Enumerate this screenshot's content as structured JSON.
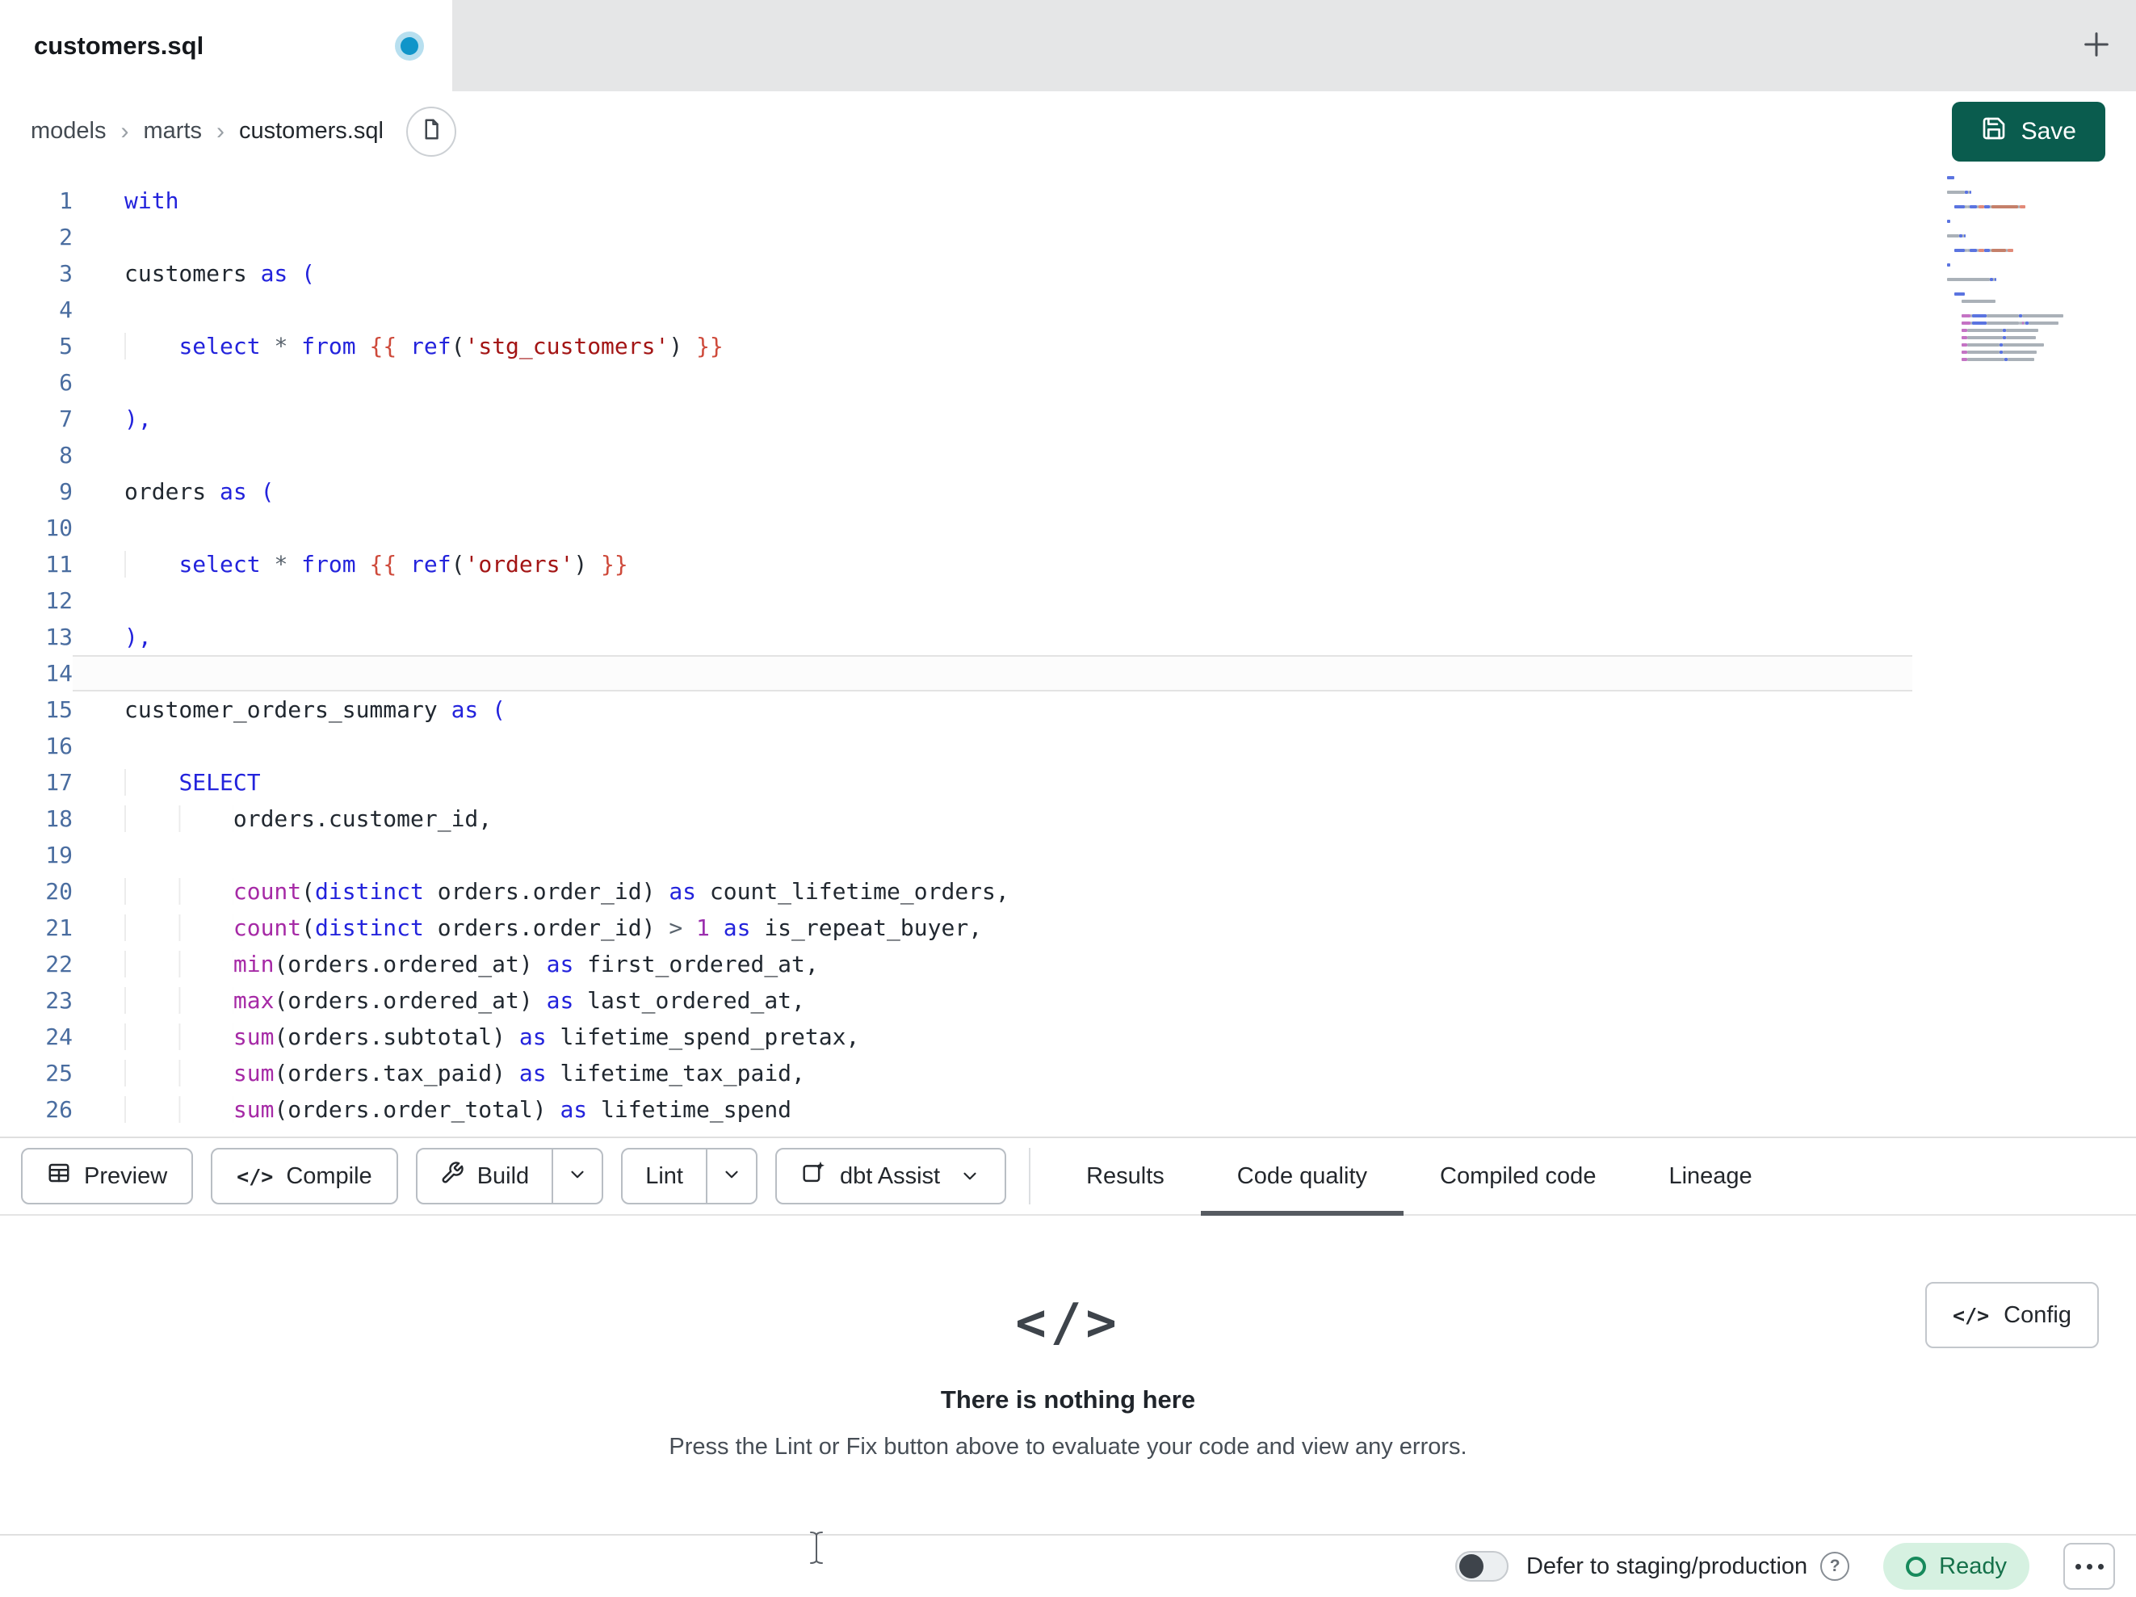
{
  "window": {
    "tab_title": "customers.sql",
    "new_tab": "+"
  },
  "breadcrumb": {
    "items": [
      "models",
      "marts",
      "customers.sql"
    ],
    "separator": "›"
  },
  "header": {
    "save_label": "Save"
  },
  "editor": {
    "active_line": 14,
    "lines": [
      [
        [
          "kw",
          "with"
        ]
      ],
      [],
      [
        [
          "pl",
          "customers "
        ],
        [
          "kw",
          "as"
        ],
        [
          "pl",
          " "
        ],
        [
          "kw",
          "("
        ]
      ],
      [],
      [
        [
          "ind",
          "    "
        ],
        [
          "kw",
          "select"
        ],
        [
          "pl",
          " "
        ],
        [
          "op",
          "*"
        ],
        [
          "pl",
          " "
        ],
        [
          "kw",
          "from"
        ],
        [
          "pl",
          " "
        ],
        [
          "jj",
          "{{ "
        ],
        [
          "kw",
          "ref"
        ],
        [
          "pl",
          "("
        ],
        [
          "st",
          "'stg_customers'"
        ],
        [
          "pl",
          ")"
        ],
        [
          "jj",
          " }}"
        ]
      ],
      [],
      [
        [
          "kw",
          "),"
        ]
      ],
      [],
      [
        [
          "pl",
          "orders "
        ],
        [
          "kw",
          "as"
        ],
        [
          "pl",
          " "
        ],
        [
          "kw",
          "("
        ]
      ],
      [],
      [
        [
          "ind",
          "    "
        ],
        [
          "kw",
          "select"
        ],
        [
          "pl",
          " "
        ],
        [
          "op",
          "*"
        ],
        [
          "pl",
          " "
        ],
        [
          "kw",
          "from"
        ],
        [
          "pl",
          " "
        ],
        [
          "jj",
          "{{ "
        ],
        [
          "kw",
          "ref"
        ],
        [
          "pl",
          "("
        ],
        [
          "st",
          "'orders'"
        ],
        [
          "pl",
          ")"
        ],
        [
          "jj",
          " }}"
        ]
      ],
      [],
      [
        [
          "kw",
          "),"
        ]
      ],
      [],
      [
        [
          "pl",
          "customer_orders_summary "
        ],
        [
          "kw",
          "as"
        ],
        [
          "pl",
          " "
        ],
        [
          "kw",
          "("
        ]
      ],
      [],
      [
        [
          "ind",
          "    "
        ],
        [
          "kw",
          "SELECT"
        ]
      ],
      [
        [
          "ind",
          "        "
        ],
        [
          "pl",
          "orders.customer_id,"
        ]
      ],
      [],
      [
        [
          "ind",
          "        "
        ],
        [
          "fn",
          "count"
        ],
        [
          "pl",
          "("
        ],
        [
          "kw",
          "distinct"
        ],
        [
          "pl",
          " orders.order_id) "
        ],
        [
          "kw",
          "as"
        ],
        [
          "pl",
          " count_lifetime_orders,"
        ]
      ],
      [
        [
          "ind",
          "        "
        ],
        [
          "fn",
          "count"
        ],
        [
          "pl",
          "("
        ],
        [
          "kw",
          "distinct"
        ],
        [
          "pl",
          " orders.order_id) "
        ],
        [
          "op",
          ">"
        ],
        [
          "pl",
          " "
        ],
        [
          "nm",
          "1"
        ],
        [
          "pl",
          " "
        ],
        [
          "kw",
          "as"
        ],
        [
          "pl",
          " is_repeat_buyer,"
        ]
      ],
      [
        [
          "ind",
          "        "
        ],
        [
          "fn",
          "min"
        ],
        [
          "pl",
          "(orders.ordered_at) "
        ],
        [
          "kw",
          "as"
        ],
        [
          "pl",
          " first_ordered_at,"
        ]
      ],
      [
        [
          "ind",
          "        "
        ],
        [
          "fn",
          "max"
        ],
        [
          "pl",
          "(orders.ordered_at) "
        ],
        [
          "kw",
          "as"
        ],
        [
          "pl",
          " last_ordered_at,"
        ]
      ],
      [
        [
          "ind",
          "        "
        ],
        [
          "fn",
          "sum"
        ],
        [
          "pl",
          "(orders.subtotal) "
        ],
        [
          "kw",
          "as"
        ],
        [
          "pl",
          " lifetime_spend_pretax,"
        ]
      ],
      [
        [
          "ind",
          "        "
        ],
        [
          "fn",
          "sum"
        ],
        [
          "pl",
          "(orders.tax_paid) "
        ],
        [
          "kw",
          "as"
        ],
        [
          "pl",
          " lifetime_tax_paid,"
        ]
      ],
      [
        [
          "ind",
          "        "
        ],
        [
          "fn",
          "sum"
        ],
        [
          "pl",
          "(orders.order_total) "
        ],
        [
          "kw",
          "as"
        ],
        [
          "pl",
          " lifetime_spend"
        ]
      ]
    ]
  },
  "toolbar": {
    "preview": "Preview",
    "compile": "Compile",
    "build": "Build",
    "lint": "Lint",
    "assist": "dbt Assist",
    "compile_glyph": "</>",
    "tabs": [
      {
        "label": "Results",
        "active": false
      },
      {
        "label": "Code quality",
        "active": true
      },
      {
        "label": "Compiled code",
        "active": false
      },
      {
        "label": "Lineage",
        "active": false
      }
    ]
  },
  "results_panel": {
    "config_label": "Config",
    "config_glyph": "</>",
    "empty_icon": "</>",
    "empty_title": "There is nothing here",
    "empty_description": "Press the Lint or Fix button above to evaluate your code and view any errors."
  },
  "statusbar": {
    "defer_label": "Defer to staging/production",
    "help_glyph": "?",
    "ready_label": "Ready",
    "toggle_on": false
  },
  "colors": {
    "save_button": "#0A5C4E",
    "unsaved_dot": "#1095C9",
    "tabbar_bg": "#E5E6E7",
    "ready_bg": "#D6F1E1",
    "ready_text": "#15714A",
    "keyword": "#2323DC",
    "function": "#A62AA6",
    "string": "#A31515",
    "jinja": "#CE4A3B",
    "number": "#9B2FAE",
    "line_number": "#4A6DA0",
    "active_tab_underline": "#565B61"
  }
}
